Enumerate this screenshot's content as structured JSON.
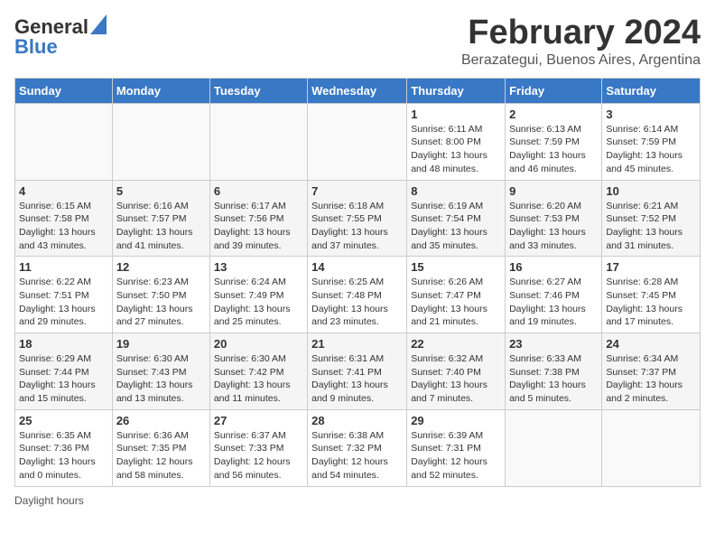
{
  "header": {
    "logo_general": "General",
    "logo_blue": "Blue",
    "title": "February 2024",
    "subtitle": "Berazategui, Buenos Aires, Argentina"
  },
  "days_of_week": [
    "Sunday",
    "Monday",
    "Tuesday",
    "Wednesday",
    "Thursday",
    "Friday",
    "Saturday"
  ],
  "weeks": [
    [
      {
        "day": "",
        "info": ""
      },
      {
        "day": "",
        "info": ""
      },
      {
        "day": "",
        "info": ""
      },
      {
        "day": "",
        "info": ""
      },
      {
        "day": "1",
        "info": "Sunrise: 6:11 AM\nSunset: 8:00 PM\nDaylight: 13 hours and 48 minutes."
      },
      {
        "day": "2",
        "info": "Sunrise: 6:13 AM\nSunset: 7:59 PM\nDaylight: 13 hours and 46 minutes."
      },
      {
        "day": "3",
        "info": "Sunrise: 6:14 AM\nSunset: 7:59 PM\nDaylight: 13 hours and 45 minutes."
      }
    ],
    [
      {
        "day": "4",
        "info": "Sunrise: 6:15 AM\nSunset: 7:58 PM\nDaylight: 13 hours and 43 minutes."
      },
      {
        "day": "5",
        "info": "Sunrise: 6:16 AM\nSunset: 7:57 PM\nDaylight: 13 hours and 41 minutes."
      },
      {
        "day": "6",
        "info": "Sunrise: 6:17 AM\nSunset: 7:56 PM\nDaylight: 13 hours and 39 minutes."
      },
      {
        "day": "7",
        "info": "Sunrise: 6:18 AM\nSunset: 7:55 PM\nDaylight: 13 hours and 37 minutes."
      },
      {
        "day": "8",
        "info": "Sunrise: 6:19 AM\nSunset: 7:54 PM\nDaylight: 13 hours and 35 minutes."
      },
      {
        "day": "9",
        "info": "Sunrise: 6:20 AM\nSunset: 7:53 PM\nDaylight: 13 hours and 33 minutes."
      },
      {
        "day": "10",
        "info": "Sunrise: 6:21 AM\nSunset: 7:52 PM\nDaylight: 13 hours and 31 minutes."
      }
    ],
    [
      {
        "day": "11",
        "info": "Sunrise: 6:22 AM\nSunset: 7:51 PM\nDaylight: 13 hours and 29 minutes."
      },
      {
        "day": "12",
        "info": "Sunrise: 6:23 AM\nSunset: 7:50 PM\nDaylight: 13 hours and 27 minutes."
      },
      {
        "day": "13",
        "info": "Sunrise: 6:24 AM\nSunset: 7:49 PM\nDaylight: 13 hours and 25 minutes."
      },
      {
        "day": "14",
        "info": "Sunrise: 6:25 AM\nSunset: 7:48 PM\nDaylight: 13 hours and 23 minutes."
      },
      {
        "day": "15",
        "info": "Sunrise: 6:26 AM\nSunset: 7:47 PM\nDaylight: 13 hours and 21 minutes."
      },
      {
        "day": "16",
        "info": "Sunrise: 6:27 AM\nSunset: 7:46 PM\nDaylight: 13 hours and 19 minutes."
      },
      {
        "day": "17",
        "info": "Sunrise: 6:28 AM\nSunset: 7:45 PM\nDaylight: 13 hours and 17 minutes."
      }
    ],
    [
      {
        "day": "18",
        "info": "Sunrise: 6:29 AM\nSunset: 7:44 PM\nDaylight: 13 hours and 15 minutes."
      },
      {
        "day": "19",
        "info": "Sunrise: 6:30 AM\nSunset: 7:43 PM\nDaylight: 13 hours and 13 minutes."
      },
      {
        "day": "20",
        "info": "Sunrise: 6:30 AM\nSunset: 7:42 PM\nDaylight: 13 hours and 11 minutes."
      },
      {
        "day": "21",
        "info": "Sunrise: 6:31 AM\nSunset: 7:41 PM\nDaylight: 13 hours and 9 minutes."
      },
      {
        "day": "22",
        "info": "Sunrise: 6:32 AM\nSunset: 7:40 PM\nDaylight: 13 hours and 7 minutes."
      },
      {
        "day": "23",
        "info": "Sunrise: 6:33 AM\nSunset: 7:38 PM\nDaylight: 13 hours and 5 minutes."
      },
      {
        "day": "24",
        "info": "Sunrise: 6:34 AM\nSunset: 7:37 PM\nDaylight: 13 hours and 2 minutes."
      }
    ],
    [
      {
        "day": "25",
        "info": "Sunrise: 6:35 AM\nSunset: 7:36 PM\nDaylight: 13 hours and 0 minutes."
      },
      {
        "day": "26",
        "info": "Sunrise: 6:36 AM\nSunset: 7:35 PM\nDaylight: 12 hours and 58 minutes."
      },
      {
        "day": "27",
        "info": "Sunrise: 6:37 AM\nSunset: 7:33 PM\nDaylight: 12 hours and 56 minutes."
      },
      {
        "day": "28",
        "info": "Sunrise: 6:38 AM\nSunset: 7:32 PM\nDaylight: 12 hours and 54 minutes."
      },
      {
        "day": "29",
        "info": "Sunrise: 6:39 AM\nSunset: 7:31 PM\nDaylight: 12 hours and 52 minutes."
      },
      {
        "day": "",
        "info": ""
      },
      {
        "day": "",
        "info": ""
      }
    ]
  ],
  "footer": {
    "note": "Daylight hours"
  }
}
